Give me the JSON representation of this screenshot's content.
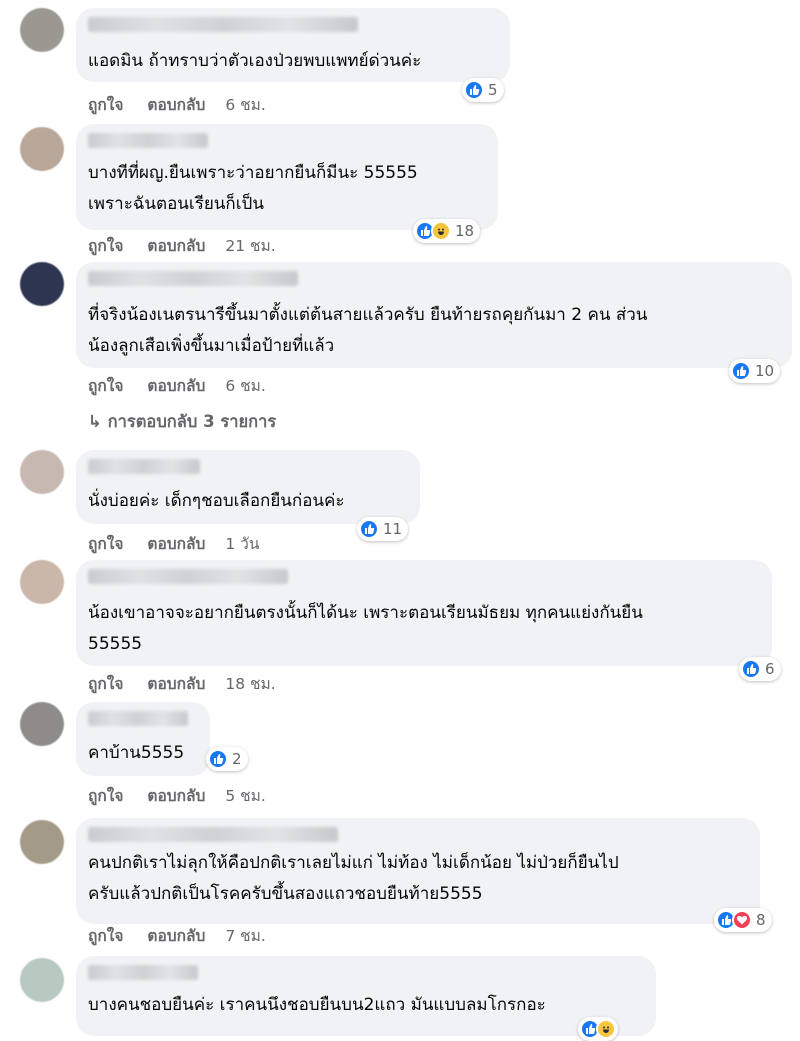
{
  "comments": [
    {
      "text_lines": [
        "แอดมิน ถ้าทราบว่าตัวเองป่วยพบแพทย์ด่วนค่ะ"
      ],
      "like": "ถูกใจ",
      "reply": "ตอบกลับ",
      "time": "6 ชม.",
      "reaction_count": "5",
      "reactions": [
        "like"
      ]
    },
    {
      "text_lines": [
        "บางทีที่ผญ.ยืนเพราะว่าอยากยืนก็มีนะ 55555",
        "เพราะฉันตอนเรียนก็เป็น"
      ],
      "like": "ถูกใจ",
      "reply": "ตอบกลับ",
      "time": "21 ชม.",
      "reaction_count": "18",
      "reactions": [
        "like",
        "haha"
      ]
    },
    {
      "text_lines": [
        "ที่จริงน้องเนตรนารีขึ้นมาตั้งแต่ต้นสายแล้วครับ ยืนท้ายรถคุยกันมา 2 คน ส่วน",
        "น้องลูกเสือเพิ่งขึ้นมาเมื่อป้ายที่แล้ว"
      ],
      "like": "ถูกใจ",
      "reply": "ตอบกลับ",
      "time": "6 ชม.",
      "reaction_count": "10",
      "reactions": [
        "like"
      ],
      "replies_label": "การตอบกลับ 3 รายการ"
    },
    {
      "text_lines": [
        "นั่งบ่อยค่ะ เด็กๆชอบเลือกยืนก่อนค่ะ"
      ],
      "like": "ถูกใจ",
      "reply": "ตอบกลับ",
      "time": "1 วัน",
      "reaction_count": "11",
      "reactions": [
        "like"
      ]
    },
    {
      "text_lines": [
        "น้องเขาอาจจะอยากยืนตรงนั้นก็ได้นะ เพราะตอนเรียนมัธยม ทุกคนแย่งกันยืน",
        "55555"
      ],
      "like": "ถูกใจ",
      "reply": "ตอบกลับ",
      "time": "18 ชม.",
      "reaction_count": "6",
      "reactions": [
        "like"
      ]
    },
    {
      "text_lines": [
        "คาบ้าน5555"
      ],
      "like": "ถูกใจ",
      "reply": "ตอบกลับ",
      "time": "5 ชม.",
      "reaction_count": "2",
      "reactions": [
        "like"
      ]
    },
    {
      "text_lines": [
        "คนปกติเราไม่ลุกให้คือปกติเราเลยไม่แก่ ไม่ท้อง ไม่เด็กน้อย ไม่ป่วยก็ยืนไป",
        "ครับแล้วปกติเป็นโรคครับขึ้นสองแถวชอบยืนท้าย5555"
      ],
      "like": "ถูกใจ",
      "reply": "ตอบกลับ",
      "time": "7 ชม.",
      "reaction_count": "8",
      "reactions": [
        "like",
        "love"
      ]
    },
    {
      "text_lines": [
        "บางคนชอบยืนค่ะ เราคนนึงชอบยืนบน2แถว มันแบบลมโกรกอะ"
      ]
    }
  ],
  "colors": {
    "bubble": "#f0f2f5",
    "meta": "#65676b",
    "like": "#1877f2",
    "haha": "#f7c53c",
    "love": "#f33e58"
  }
}
